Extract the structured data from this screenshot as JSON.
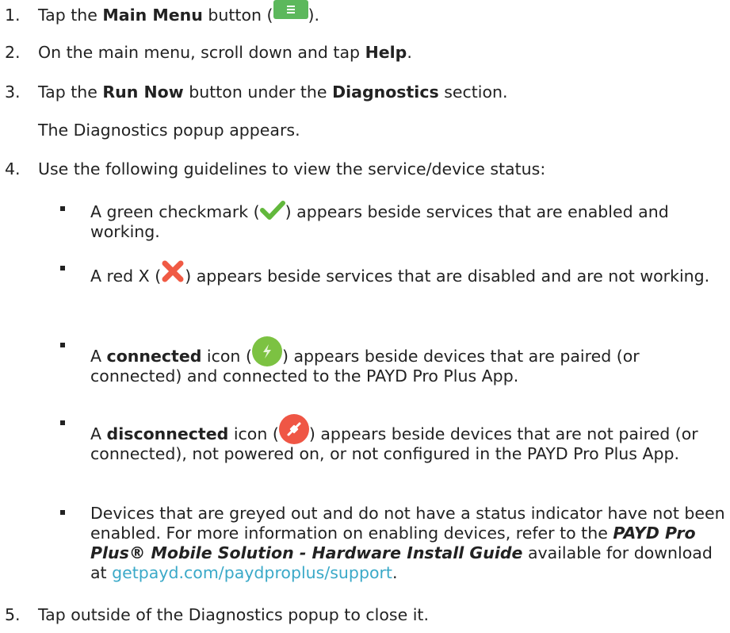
{
  "steps": [
    {
      "num": "1.",
      "pre": "Tap the ",
      "bold": "Main Menu",
      "mid": " button (",
      "post": ")."
    },
    {
      "num": "2.",
      "pre": "On the main menu, scroll down and tap ",
      "bold": "Help",
      "post": "."
    },
    {
      "num": "3.",
      "pre": "Tap the ",
      "bold": "Run Now",
      "mid": " button under the ",
      "bold2": "Diagnostics",
      "post": " section.",
      "note": "The Diagnostics popup appears."
    },
    {
      "num": "4.",
      "text": "Use the following guidelines to view the service/device status:"
    },
    {
      "num": "5.",
      "text": "Tap outside of the Diagnostics popup to close it."
    }
  ],
  "bullets": [
    {
      "pre": "A green checkmark (",
      "post": ") appears beside services that are enabled and working."
    },
    {
      "pre": "A red X (",
      "post": ") appears beside services that are disabled and are not working."
    },
    {
      "pre": "A ",
      "bold": "connected",
      "mid": " icon (",
      "post": ") appears beside devices that are paired (or connected) and connected to the PAYD Pro Plus App."
    },
    {
      "pre": "A ",
      "bold": "disconnected",
      "mid": " icon (",
      "post": ") appears beside devices that are not paired (or connected), not powered on, or not configured in the PAYD Pro Plus App."
    },
    {
      "pre": "Devices that are greyed out and do not have a status indicator have not been enabled. For more information on enabling devices, refer to the ",
      "ref": "PAYD Pro Plus® Mobile Solution - Hardware Install Guide",
      "mid": " available for download at ",
      "link": "getpayd.com/paydproplus/support",
      "post": "."
    }
  ],
  "icons": {
    "menu": "menu-icon",
    "check": "checkmark-icon",
    "x": "red-x-icon",
    "connected": "connected-icon",
    "disconnected": "disconnected-icon"
  },
  "colors": {
    "menu_green": "#5cb85c",
    "check_green": "#62b83c",
    "x_red": "#f05a44",
    "connected_green": "#7cc242",
    "disconnected_red": "#ef5645",
    "link": "#3aa9c8"
  }
}
